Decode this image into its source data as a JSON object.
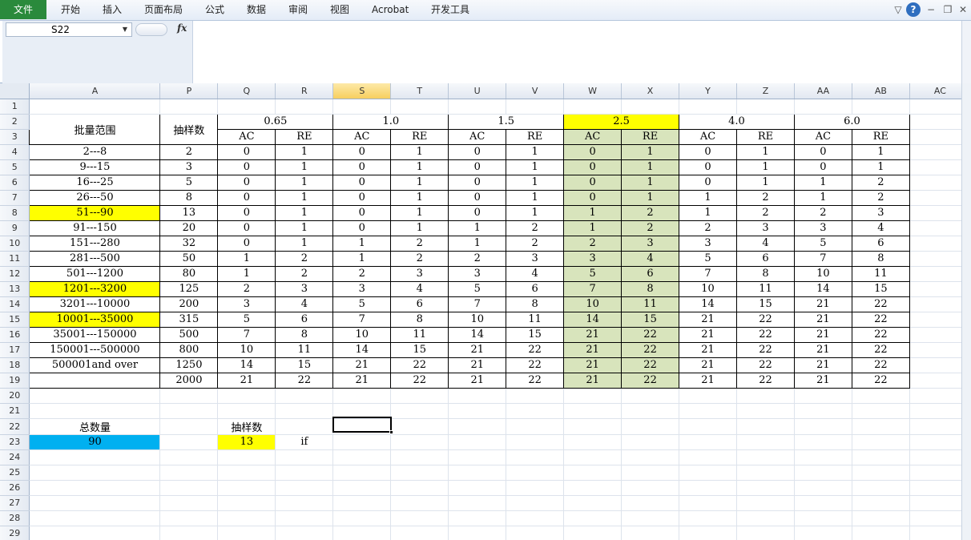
{
  "ribbon": {
    "file_tab": "文件",
    "tabs": [
      "开始",
      "插入",
      "页面布局",
      "公式",
      "数据",
      "审阅",
      "视图",
      "Acrobat",
      "开发工具"
    ]
  },
  "formula_bar": {
    "name_box": "S22",
    "fx_label": "fx",
    "formula": ""
  },
  "columns": [
    "A",
    "P",
    "Q",
    "R",
    "S",
    "T",
    "U",
    "V",
    "W",
    "X",
    "Y",
    "Z",
    "AA",
    "AB",
    "AC"
  ],
  "selected_column": "S",
  "table": {
    "range_header": "批量范围",
    "sample_header": "抽样数",
    "aql_levels": [
      "0.65",
      "1.0",
      "1.5",
      "2.5",
      "4.0",
      "6.0"
    ],
    "ac_label": "AC",
    "re_label": "RE",
    "rows": [
      {
        "range": "2---8",
        "n": "2",
        "v": [
          "0",
          "1",
          "0",
          "1",
          "0",
          "1",
          "0",
          "1",
          "0",
          "1",
          "0",
          "1"
        ]
      },
      {
        "range": "9---15",
        "n": "3",
        "v": [
          "0",
          "1",
          "0",
          "1",
          "0",
          "1",
          "0",
          "1",
          "0",
          "1",
          "0",
          "1"
        ]
      },
      {
        "range": "16---25",
        "n": "5",
        "v": [
          "0",
          "1",
          "0",
          "1",
          "0",
          "1",
          "0",
          "1",
          "0",
          "1",
          "1",
          "2"
        ]
      },
      {
        "range": "26---50",
        "n": "8",
        "v": [
          "0",
          "1",
          "0",
          "1",
          "0",
          "1",
          "0",
          "1",
          "1",
          "2",
          "1",
          "2"
        ]
      },
      {
        "range": "51---90",
        "n": "13",
        "v": [
          "0",
          "1",
          "0",
          "1",
          "0",
          "1",
          "1",
          "2",
          "1",
          "2",
          "2",
          "3"
        ]
      },
      {
        "range": "91---150",
        "n": "20",
        "v": [
          "0",
          "1",
          "0",
          "1",
          "1",
          "2",
          "1",
          "2",
          "2",
          "3",
          "3",
          "4"
        ]
      },
      {
        "range": "151---280",
        "n": "32",
        "v": [
          "0",
          "1",
          "1",
          "2",
          "1",
          "2",
          "2",
          "3",
          "3",
          "4",
          "5",
          "6"
        ]
      },
      {
        "range": "281---500",
        "n": "50",
        "v": [
          "1",
          "2",
          "1",
          "2",
          "2",
          "3",
          "3",
          "4",
          "5",
          "6",
          "7",
          "8"
        ]
      },
      {
        "range": "501---1200",
        "n": "80",
        "v": [
          "1",
          "2",
          "2",
          "3",
          "3",
          "4",
          "5",
          "6",
          "7",
          "8",
          "10",
          "11"
        ]
      },
      {
        "range": "1201---3200",
        "n": "125",
        "v": [
          "2",
          "3",
          "3",
          "4",
          "5",
          "6",
          "7",
          "8",
          "10",
          "11",
          "14",
          "15"
        ]
      },
      {
        "range": "3201---10000",
        "n": "200",
        "v": [
          "3",
          "4",
          "5",
          "6",
          "7",
          "8",
          "10",
          "11",
          "14",
          "15",
          "21",
          "22"
        ]
      },
      {
        "range": "10001---35000",
        "n": "315",
        "v": [
          "5",
          "6",
          "7",
          "8",
          "10",
          "11",
          "14",
          "15",
          "21",
          "22",
          "21",
          "22"
        ]
      },
      {
        "range": "35001---150000",
        "n": "500",
        "v": [
          "7",
          "8",
          "10",
          "11",
          "14",
          "15",
          "21",
          "22",
          "21",
          "22",
          "21",
          "22"
        ]
      },
      {
        "range": "150001---500000",
        "n": "800",
        "v": [
          "10",
          "11",
          "14",
          "15",
          "21",
          "22",
          "21",
          "22",
          "21",
          "22",
          "21",
          "22"
        ]
      },
      {
        "range": "500001and over",
        "n": "1250",
        "v": [
          "14",
          "15",
          "21",
          "22",
          "21",
          "22",
          "21",
          "22",
          "21",
          "22",
          "21",
          "22"
        ]
      },
      {
        "range": "",
        "n": "2000",
        "v": [
          "21",
          "22",
          "21",
          "22",
          "21",
          "22",
          "21",
          "22",
          "21",
          "22",
          "21",
          "22"
        ]
      }
    ]
  },
  "summary": {
    "total_label": "总数量",
    "total_value": "90",
    "sample_label": "抽样数",
    "sample_value": "13",
    "note": "if"
  },
  "colors": {
    "highlight_yellow": "#ffff00",
    "highlight_green": "#d8e4bc",
    "highlight_blue": "#00b0f0",
    "file_tab": "#2a8a3c"
  }
}
